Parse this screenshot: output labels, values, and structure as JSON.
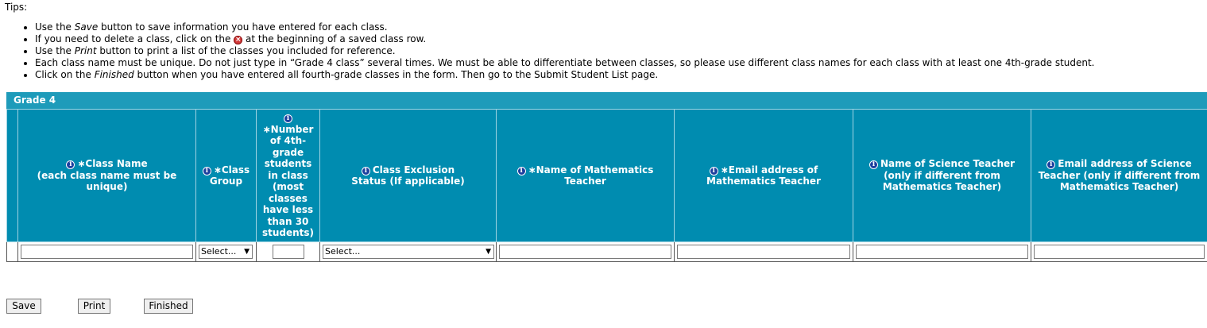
{
  "tips": {
    "title": "Tips:",
    "items": [
      {
        "before": "Use the ",
        "em": "Save",
        "after": " button to save information you have entered for each class."
      },
      {
        "before": "If you need to delete a class, click on the ",
        "icon": "delete-x-icon",
        "after": " at the beginning of a saved class row."
      },
      {
        "before": "Use the ",
        "em": "Print",
        "after": " button to print a list of the classes you included for reference."
      },
      {
        "before": "Each class name must be unique. Do not just type in “Grade 4 class” several times. We must be able to differentiate between classes, so please use different class names for each class with at least one 4th-grade student.",
        "after": ""
      },
      {
        "before": "Click on the ",
        "em": "Finished",
        "after": " button when you have entered all fourth-grade classes in the form. Then go to the Submit Student List page."
      }
    ]
  },
  "grid": {
    "grade_title": "Grade 4",
    "required_marker": "∗",
    "info_icon": "i",
    "columns": {
      "class_name": {
        "line1": "Class Name",
        "line2": "(each class name must be unique)"
      },
      "class_group": {
        "line1": "Class",
        "line2": "Group"
      },
      "num_students": {
        "line1": "Number of 4th-grade students in class",
        "line2": "(most classes have less than 30 students)"
      },
      "exclusion": {
        "line1": "Class Exclusion",
        "line2": "Status (If applicable)"
      },
      "math_teacher": {
        "line1": "Name of Mathematics Teacher"
      },
      "math_email": {
        "line1": "Email address of Mathematics Teacher"
      },
      "sci_teacher": {
        "line1": "Name of Science Teacher",
        "line2": "(only if different from Mathematics Teacher)"
      },
      "sci_email": {
        "line1": "Email address of Science Teacher (only if different from Mathematics Teacher)"
      }
    },
    "row": {
      "class_name": "",
      "class_group": "Select...",
      "num_students": "",
      "exclusion": "Select...",
      "math_teacher": "",
      "math_email": "",
      "sci_teacher": "",
      "sci_email": ""
    }
  },
  "buttons": {
    "save": "Save",
    "print": "Print",
    "finished": "Finished"
  },
  "colors": {
    "header_blue": "#008cb0",
    "grade_bar_blue": "#1e9bba",
    "info_icon_blue": "#1c3f9e",
    "delete_icon_red": "#d23a3a"
  }
}
